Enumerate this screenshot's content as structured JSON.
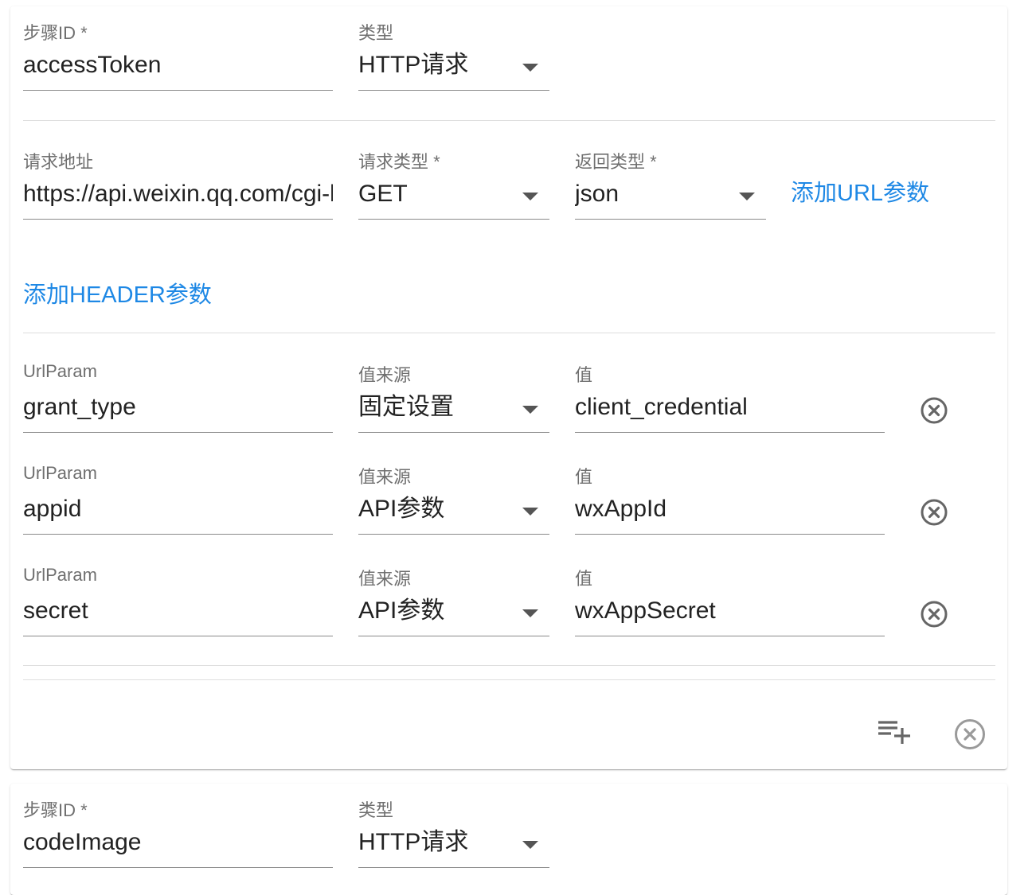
{
  "labels": {
    "step_id": "步骤ID *",
    "type": "类型",
    "request_url": "请求地址",
    "request_method": "请求类型 *",
    "response_type": "返回类型 *",
    "url_param": "UrlParam",
    "value_source": "值来源",
    "value": "值"
  },
  "step1": {
    "step_id": "accessToken",
    "type": "HTTP请求",
    "request_url": "https://api.weixin.qq.com/cgi-bin/token",
    "request_method": "GET",
    "response_type": "json",
    "add_url_param": "添加URL参数",
    "add_header_param": "添加HEADER参数",
    "params": [
      {
        "name": "grant_type",
        "source": "固定设置",
        "value": "client_credential"
      },
      {
        "name": "appid",
        "source": "API参数",
        "value": "wxAppId"
      },
      {
        "name": "secret",
        "source": "API参数",
        "value": "wxAppSecret"
      }
    ]
  },
  "step2": {
    "step_id": "codeImage",
    "type": "HTTP请求"
  },
  "icons": {
    "remove": "cancel-circle-icon",
    "add_step": "playlist-add-icon"
  }
}
